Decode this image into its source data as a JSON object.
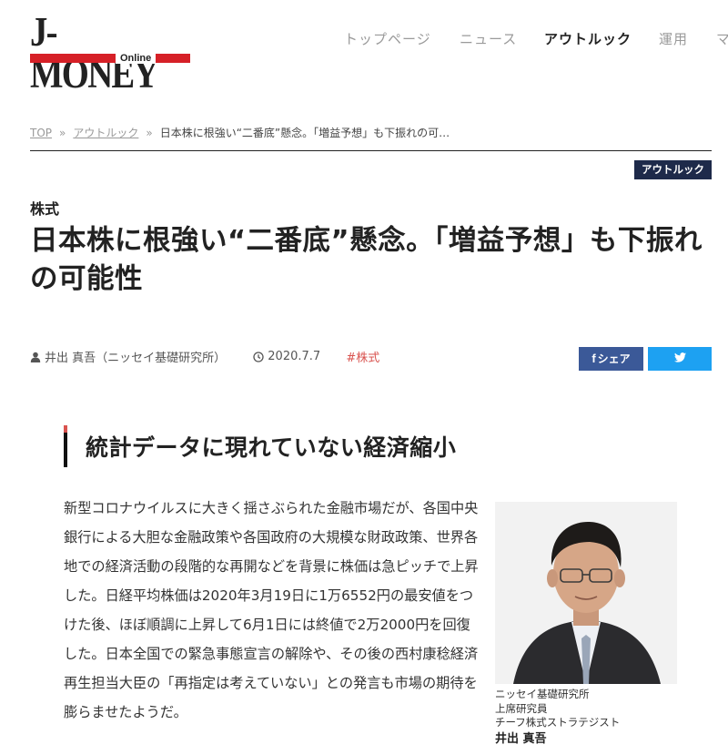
{
  "logo": {
    "main": "J-MONEY",
    "sub": "Online"
  },
  "nav": [
    {
      "label": "トップページ",
      "active": false
    },
    {
      "label": "ニュース",
      "active": false
    },
    {
      "label": "アウトルック",
      "active": true
    },
    {
      "label": "運用",
      "active": false
    },
    {
      "label": "マ",
      "active": false
    }
  ],
  "breadcrumb": {
    "home": "TOP",
    "section": "アウトルック",
    "separator": "»",
    "current": "日本株に根強い“二番底”懸念。「増益予想」も下振れの可…"
  },
  "category_badge": "アウトルック",
  "article": {
    "category": "株式",
    "title": "日本株に根強い“二番底”懸念。「増益予想」も下振れの可能性",
    "author": "井出 真吾（ニッセイ基礎研究所）",
    "date": "2020.7.7",
    "tag": "#株式"
  },
  "share": {
    "facebook": "シェア",
    "facebook_icon": "f",
    "twitter_icon": "twitter-bird"
  },
  "section": {
    "title": "統計データに現れていない経済縮小"
  },
  "body": [
    "新型コロナウイルスに大きく揺さぶられた金融市場だが、各国中央銀行による大胆な金融政策や各国政府の大規模な財政政策、世界各地での経済活動の段階的な再開などを背景に株価は急ピッチで上昇した。日経平均株価は2020年3月19日に1万6552円の最安値をつけた後、ほぼ順調に上昇して6月1日には終値で2万2000円を回復した。日本全国での緊急事態宣言の解除や、その後の西村康稔経済再生担当大臣の「再指定は考えていない」との発言も市場の期待を膨らませたようだ。"
  ],
  "profile": {
    "org": "ニッセイ基礎研究所",
    "title1": "上席研究員",
    "title2": "チーフ株式ストラテジスト",
    "name": "井出 真吾"
  },
  "colors": {
    "accent_red": "#d62027",
    "badge_navy": "#1e2a4a",
    "facebook": "#3b5998",
    "twitter": "#1da1f2"
  }
}
